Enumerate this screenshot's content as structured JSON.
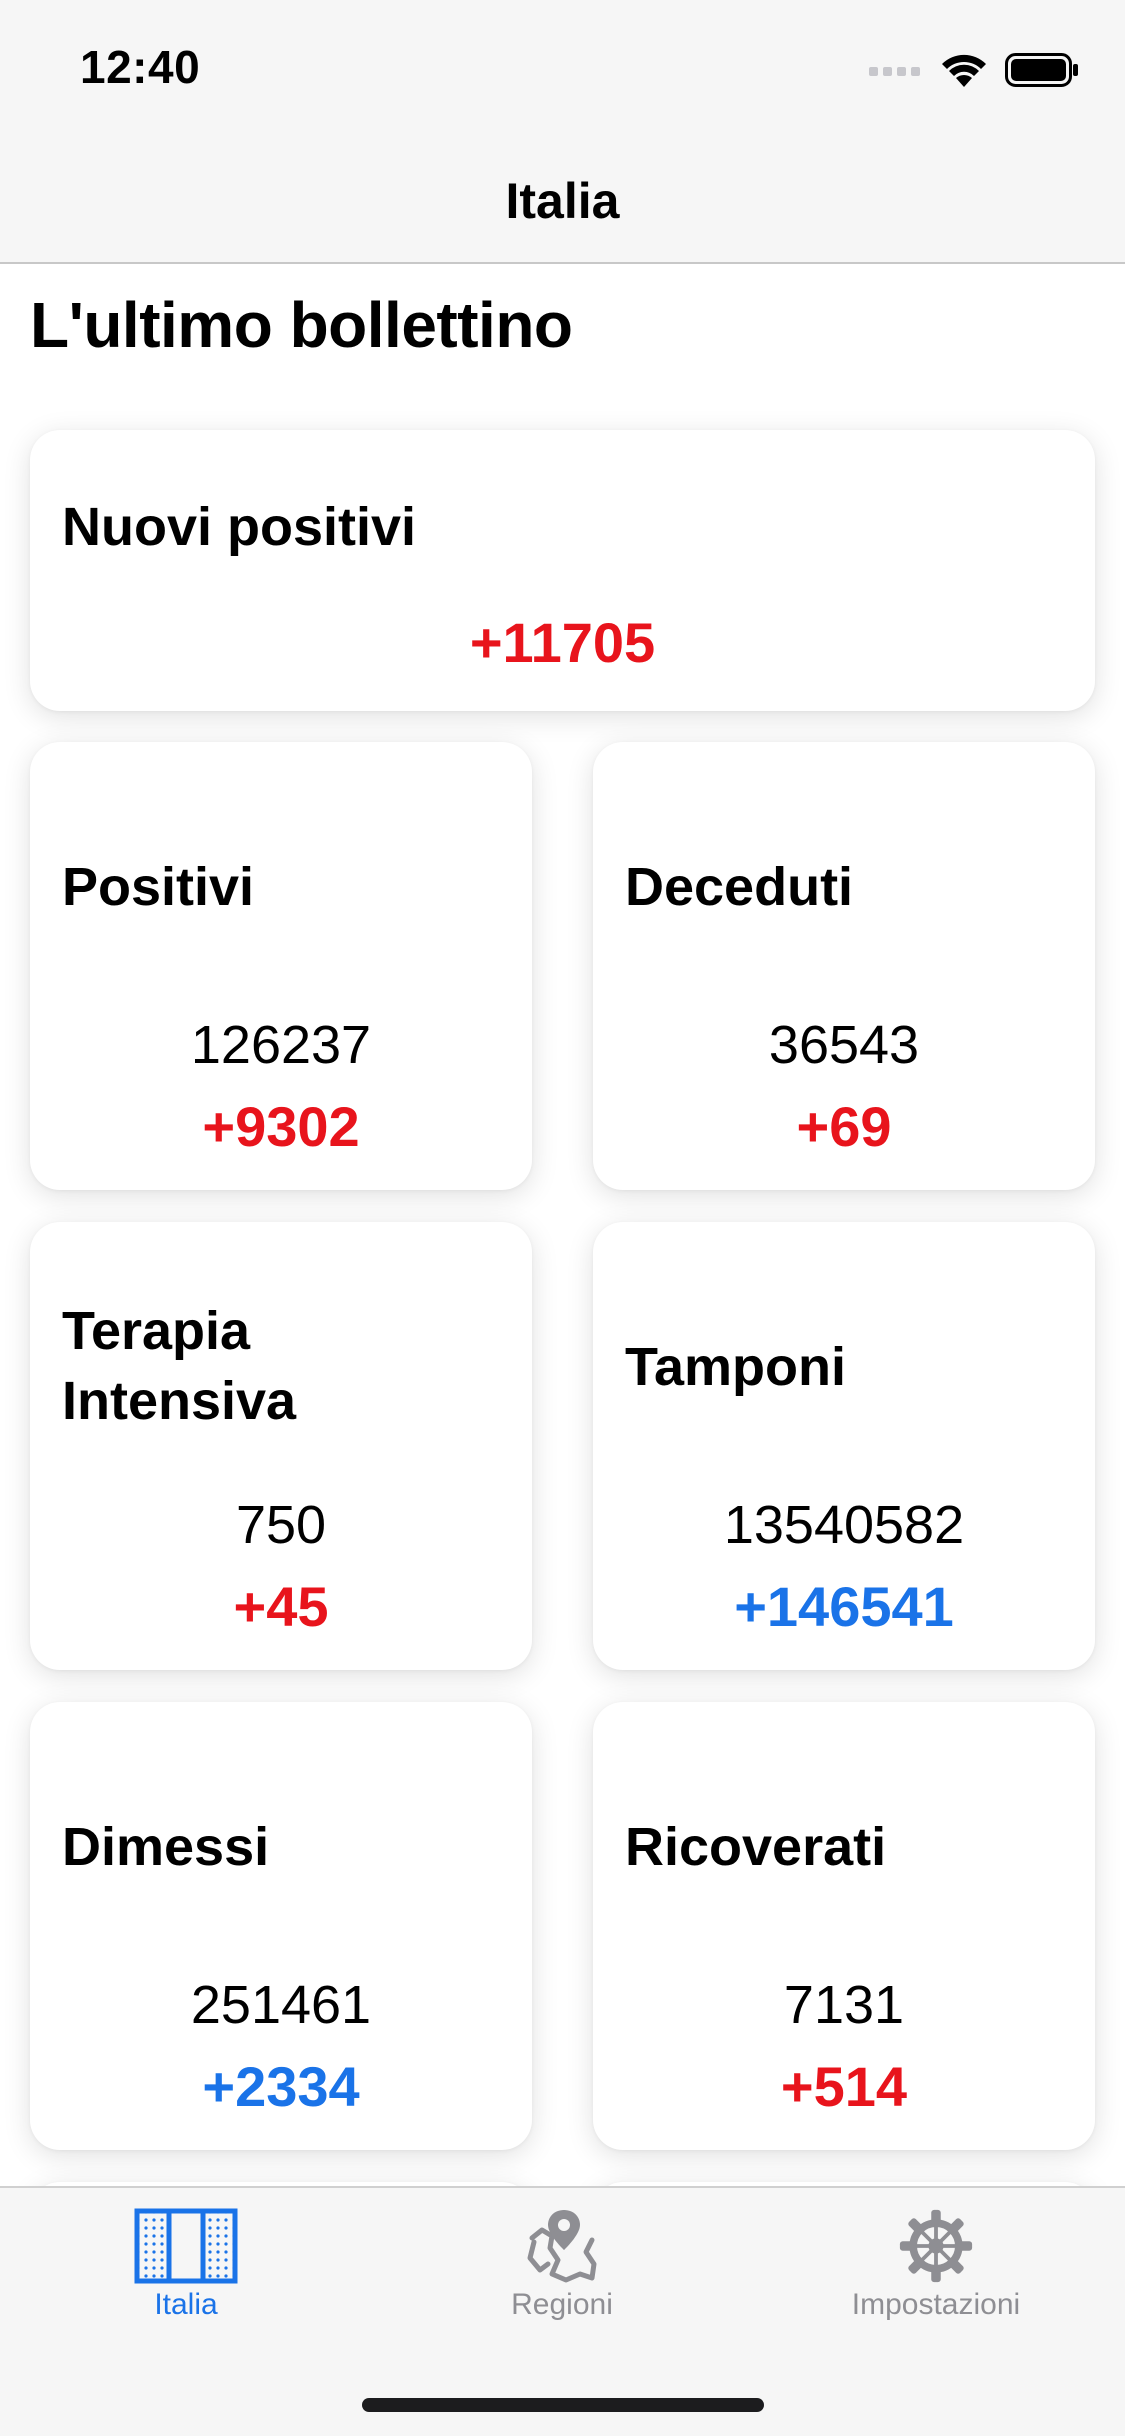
{
  "status_bar": {
    "time": "12:40"
  },
  "nav": {
    "title": "Italia"
  },
  "page": {
    "title": "L'ultimo bollettino"
  },
  "cards": {
    "nuovi_positivi": {
      "label": "Nuovi positivi",
      "delta": "+11705",
      "delta_color": "#e8141c"
    },
    "positivi": {
      "label": "Positivi",
      "value": "126237",
      "delta": "+9302",
      "delta_color": "#e8141c"
    },
    "deceduti": {
      "label": "Deceduti",
      "value": "36543",
      "delta": "+69",
      "delta_color": "#e8141c"
    },
    "terapia_intensiva": {
      "label_line1": "Terapia",
      "label_line2": "Intensiva",
      "value": "750",
      "delta": "+45",
      "delta_color": "#e8141c"
    },
    "tamponi": {
      "label": "Tamponi",
      "value": "13540582",
      "delta": "+146541",
      "delta_color": "#1a73e8"
    },
    "dimessi": {
      "label": "Dimessi",
      "value": "251461",
      "delta": "+2334",
      "delta_color": "#1a73e8"
    },
    "ricoverati": {
      "label": "Ricoverati",
      "value": "7131",
      "delta": "+514",
      "delta_color": "#e8141c"
    }
  },
  "tabbar": {
    "items": [
      {
        "label": "Italia",
        "icon": "italy-flag-icon",
        "active": true
      },
      {
        "label": "Regioni",
        "icon": "map-pin-icon",
        "active": false
      },
      {
        "label": "Impostazioni",
        "icon": "gear-icon",
        "active": false
      }
    ],
    "active_color": "#1a73e8",
    "inactive_color": "#8e8e93"
  }
}
